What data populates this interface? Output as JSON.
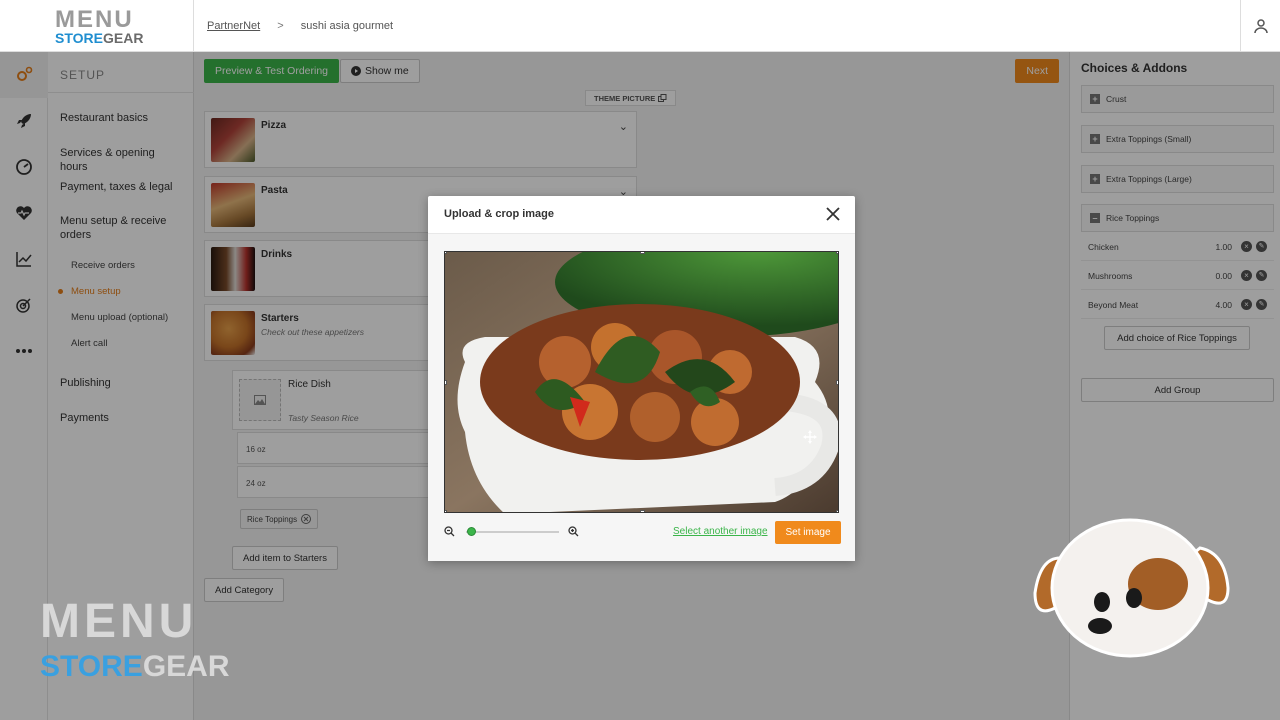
{
  "topbar": {
    "logo_top": "MENU",
    "logo_bottom_a": "STORE",
    "logo_bottom_b": "GEAR",
    "breadcrumb_link": "PartnerNet",
    "breadcrumb_sep": ">",
    "breadcrumb_current": "sushi asia gourmet"
  },
  "sidebar": {
    "heading": "SETUP",
    "items": [
      "Restaurant basics",
      "Services & opening hours",
      "Payment, taxes & legal",
      "Menu setup & receive orders",
      "Publishing",
      "Payments"
    ],
    "subitems": [
      "Receive orders",
      "Menu setup",
      "Menu upload (optional)",
      "Alert call"
    ],
    "active_sub": "Menu setup"
  },
  "toolbar": {
    "preview_label": "Preview & Test Ordering",
    "show_me_label": "Show me",
    "next_label": "Next",
    "theme_picture_label": "THEME PICTURE"
  },
  "categories": [
    {
      "name": "Pizza",
      "desc": ""
    },
    {
      "name": "Pasta",
      "desc": ""
    },
    {
      "name": "Drinks",
      "desc": ""
    },
    {
      "name": "Starters",
      "desc": "Check out these appetizers"
    }
  ],
  "item": {
    "name": "Rice Dish",
    "desc": "Tasty Season Rice",
    "sizes": [
      "16 oz",
      "24 oz"
    ],
    "tag": "Rice Toppings",
    "add_item_label": "Add item to Starters",
    "add_category_label": "Add Category"
  },
  "right_panel": {
    "title": "Choices & Addons",
    "groups": [
      "Crust",
      "Extra Toppings (Small)",
      "Extra Toppings (Large)",
      "Rice Toppings"
    ],
    "choices": [
      {
        "name": "Chicken",
        "price": "1.00"
      },
      {
        "name": "Mushrooms",
        "price": "0.00"
      },
      {
        "name": "Beyond Meat",
        "price": "4.00"
      }
    ],
    "add_choice_label": "Add choice of Rice Toppings",
    "add_group_label": "Add Group"
  },
  "modal": {
    "title": "Upload & crop image",
    "select_another_label": "Select another image",
    "set_image_label": "Set image",
    "zoom_level": 0.05
  },
  "watermark": {
    "line1": "MENU",
    "line2_a": "STORE",
    "line2_b": "GEAR"
  },
  "colors": {
    "accent_orange": "#f08a1c",
    "accent_green": "#3bb54a",
    "brand_blue": "#1f8ed0"
  }
}
